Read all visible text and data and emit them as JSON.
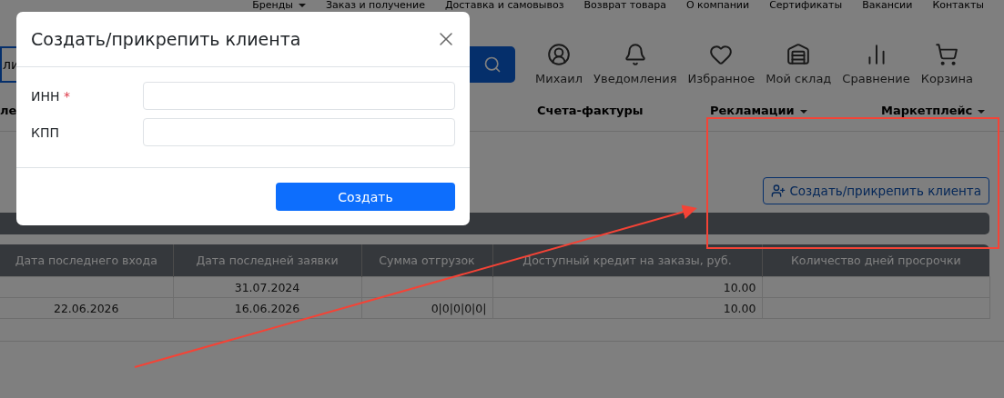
{
  "top_menu": [
    {
      "label": "Бренды",
      "dropdown": true
    },
    {
      "label": "Заказ и получение",
      "dropdown": false
    },
    {
      "label": "Доставка и самовывоз",
      "dropdown": false
    },
    {
      "label": "Возврат товара",
      "dropdown": false
    },
    {
      "label": "О компании",
      "dropdown": false
    },
    {
      "label": "Сертификаты",
      "dropdown": false
    },
    {
      "label": "Вакансии",
      "dropdown": false
    },
    {
      "label": "Контакты",
      "dropdown": false
    }
  ],
  "search": {
    "placeholder": "ли"
  },
  "header_actions": [
    {
      "kind": "user",
      "label": "Михаил"
    },
    {
      "kind": "bell",
      "label": "Уведомления"
    },
    {
      "kind": "heart",
      "label": "Избранное"
    },
    {
      "kind": "warehouse",
      "label": "Мой склад"
    },
    {
      "kind": "compare",
      "label": "Сравнение"
    },
    {
      "kind": "cart",
      "label": "Корзина"
    }
  ],
  "nav": [
    {
      "label": "ле",
      "dropdown": false
    },
    {
      "label": "Счета-фактуры",
      "dropdown": false
    },
    {
      "label": "Рекламации",
      "dropdown": true
    },
    {
      "label": "Маркетплейс",
      "dropdown": true
    }
  ],
  "create_client_button": "Создать/прикрепить клиента",
  "table": {
    "columns": [
      "Дата последнего входа",
      "Дата последней заявки",
      "Сумма отгрузок",
      "Доступный кредит на заказы, руб.",
      "Количество дней просрочки"
    ],
    "rows": [
      [
        "",
        "31.07.2024",
        "",
        "10.00",
        ""
      ],
      [
        "22.06.2026",
        "16.06.2026",
        "0|0|0|0|0|",
        "10.00",
        ""
      ]
    ]
  },
  "dialog": {
    "title": "Создать/прикрепить клиента",
    "fields": [
      {
        "label": "ИНН",
        "required_mark": "*"
      },
      {
        "label": "КПП"
      }
    ],
    "submit": "Создать"
  }
}
